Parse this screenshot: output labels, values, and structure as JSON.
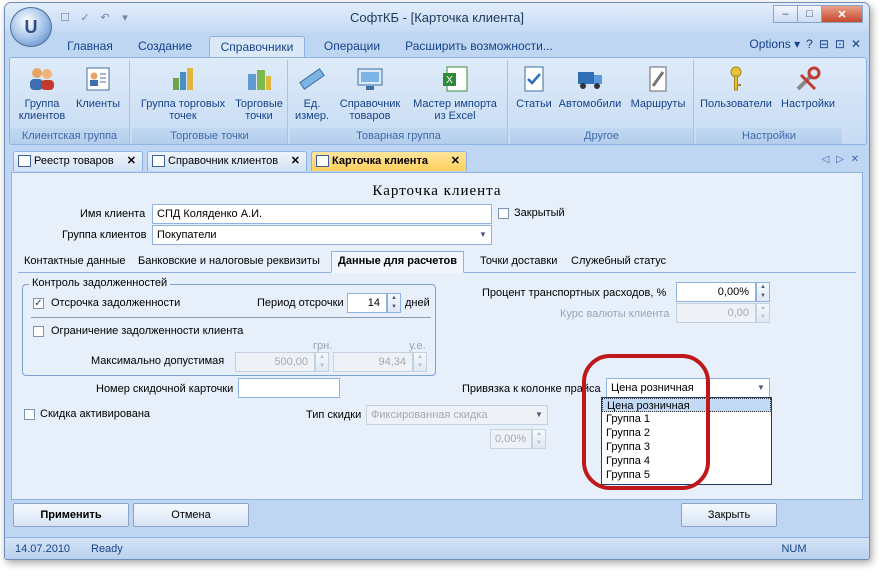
{
  "window": {
    "title": "СофтКБ - [Карточка клиента]",
    "controls": [
      "–",
      "□",
      "✕"
    ]
  },
  "quick_access": [
    "☐",
    "✓",
    "↶",
    "▾"
  ],
  "ribbon": {
    "tabs": [
      "Главная",
      "Создание",
      "Справочники",
      "Операции",
      "Расширить возможности..."
    ],
    "active_tab": "Справочники",
    "options_label": "Options",
    "options_icons": [
      "?",
      "⊟",
      "⊡",
      "✕"
    ],
    "groups": [
      {
        "label": "Клиентская группа",
        "buttons": [
          {
            "label": "Группа клиентов",
            "icon": "users-group-icon"
          },
          {
            "label": "Клиенты",
            "icon": "client-card-icon"
          }
        ]
      },
      {
        "label": "Торговые точки",
        "buttons": [
          {
            "label": "Группа торговых точек",
            "icon": "buildings-group-icon"
          },
          {
            "label": "Торговые точки",
            "icon": "buildings-icon"
          }
        ]
      },
      {
        "label": "Товарная группа",
        "buttons": [
          {
            "label": "Ед. измер.",
            "icon": "ruler-icon"
          },
          {
            "label": "Справочник товаров",
            "icon": "product-catalog-icon"
          },
          {
            "label": "Мастер импорта из Excel",
            "icon": "excel-import-icon"
          }
        ]
      },
      {
        "label": "Другое",
        "buttons": [
          {
            "label": "Статьи",
            "icon": "checklist-icon"
          },
          {
            "label": "Автомобили",
            "icon": "truck-icon"
          },
          {
            "label": "Маршруты",
            "icon": "route-icon"
          }
        ]
      },
      {
        "label": "Настройки",
        "buttons": [
          {
            "label": "Пользователи",
            "icon": "key-icon"
          },
          {
            "label": "Настройки",
            "icon": "tools-icon"
          }
        ]
      }
    ]
  },
  "doc_tabs": [
    {
      "label": "Реестр товаров",
      "close": "✕"
    },
    {
      "label": "Справочник клиентов",
      "close": "✕"
    },
    {
      "label": "Карточка клиента",
      "close": "✕"
    }
  ],
  "doc_tab_nav": "◁ ▷ ✕",
  "form": {
    "title": "Карточка клиента",
    "client_name_label": "Имя клиента",
    "client_name_value": "СПД Коляденко А.И.",
    "closed_label": "Закрытый",
    "client_group_label": "Группа клиентов",
    "client_group_value": "Покупатели",
    "tabs": [
      "Контактные данные",
      "Банковские и налоговые реквизиты",
      "Данные для расчетов",
      "Точки доставки",
      "Служебный статус"
    ],
    "debt_control": {
      "title": "Контроль задолженностей",
      "deferral_label": "Отсрочка задолженности",
      "deferral_checked": true,
      "period_label": "Период отсрочки",
      "period_value": "14",
      "days_label": "дней",
      "limit_label": "Ограничение задолженности клиента",
      "limit_checked": false,
      "currency_uah": "грн.",
      "currency_ue": "у.е.",
      "max_label": "Максимально допустимая",
      "max_uah": "500,00",
      "max_ue": "94,34"
    },
    "transport_label": "Процент транспортных расходов, %",
    "transport_value": "0,00%",
    "rate_label": "Курс валюты клиента",
    "rate_value": "0,00",
    "discount_card_label": "Номер скидочной карточки",
    "discount_card_value": "",
    "discount_active_label": "Скидка активирована",
    "discount_type_label": "Тип скидки",
    "discount_type_value": "Фиксированная скидка",
    "discount_percent_value": "0,00%",
    "price_column_label": "Привязка к колонке прайса",
    "price_column_value": "Цена розничная",
    "price_options": [
      "Цена розничная",
      "Группа 1",
      "Группа 2",
      "Группа 3",
      "Группа 4",
      "Группа 5"
    ]
  },
  "buttons": {
    "apply": "Применить",
    "cancel": "Отмена",
    "close": "Закрыть"
  },
  "status": {
    "date": "14.07.2010",
    "ready": "Ready",
    "num": "NUM"
  },
  "colors": {
    "accent": "#15428b",
    "active_tab": "#ffcf5c",
    "highlight_ring": "#c0171a"
  }
}
